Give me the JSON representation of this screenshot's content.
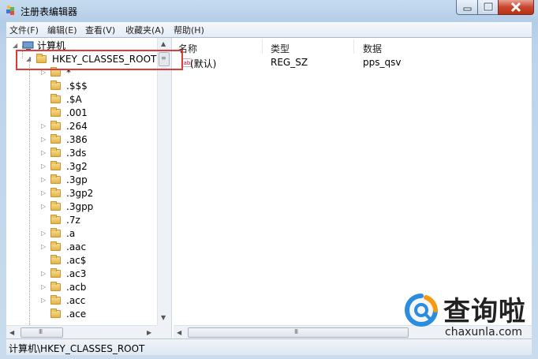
{
  "window": {
    "title": "注册表编辑器",
    "icon": "regedit-icon"
  },
  "menu": [
    "文件(F)",
    "编辑(E)",
    "查看(V)",
    "收藏夹(A)",
    "帮助(H)"
  ],
  "tree": {
    "root": "计算机",
    "selected": "HKEY_CLASSES_ROOT",
    "children": [
      "*",
      ".$$$",
      ".$A",
      ".001",
      ".264",
      ".386",
      ".3ds",
      ".3g2",
      ".3gp",
      ".3gp2",
      ".3gpp",
      ".7z",
      ".a",
      ".aac",
      ".ac$",
      ".ac3",
      ".acb",
      ".acc",
      ".ace"
    ]
  },
  "list": {
    "headers": [
      "名称",
      "类型",
      "数据"
    ],
    "rows": [
      {
        "name": "(默认)",
        "type": "REG_SZ",
        "data": "pps_qsv"
      }
    ]
  },
  "status": "计算机\\HKEY_CLASSES_ROOT",
  "watermark": {
    "cn": "查询啦",
    "en": "chaxunla.com"
  },
  "colors": {
    "highlight": "#e03a3a",
    "titlebar": "#b3cde6"
  }
}
